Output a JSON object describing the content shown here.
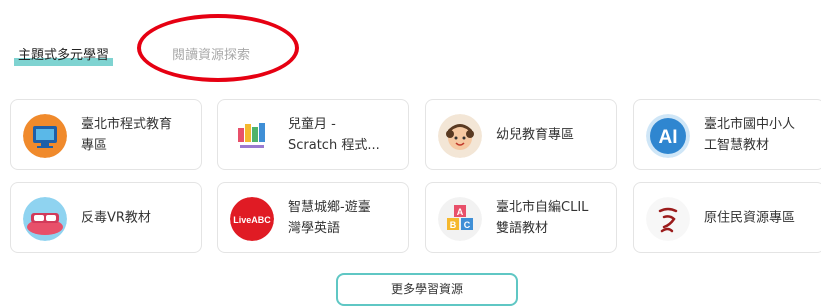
{
  "tabs": [
    {
      "label": "主題式多元學習",
      "active": true
    },
    {
      "label": "閱讀資源探索",
      "active": false
    }
  ],
  "cards": [
    {
      "line1": "臺北市程式教育",
      "line2": "專區",
      "icon": "monitor-icon"
    },
    {
      "line1": "兒童月 -",
      "line2": "Scratch 程式...",
      "icon": "childrens-month-icon"
    },
    {
      "line1": "幼兒教育專區",
      "line2": "",
      "icon": "child-face-icon"
    },
    {
      "line1": "臺北市國中小人",
      "line2": "工智慧教材",
      "icon": "ai-icon"
    },
    {
      "line1": "反毒VR教材",
      "line2": "",
      "icon": "anti-drug-vr-icon"
    },
    {
      "line1": "智慧城鄉-遊臺",
      "line2": "灣學英語",
      "icon": "liveabc-icon"
    },
    {
      "line1": "臺北市自編CLIL",
      "line2": "雙語教材",
      "icon": "abc-blocks-icon"
    },
    {
      "line1": "原住民資源專區",
      "line2": "",
      "icon": "indigenous-logo-icon"
    }
  ],
  "icon_text": {
    "ai": "AI",
    "liveabc": "LiveABC",
    "blocks": [
      "A",
      "B",
      "C"
    ]
  },
  "more_button": "更多學習資源",
  "colors": {
    "accent": "#7fd3d1",
    "button_border": "#5fc7c4",
    "annotation_circle": "#e60012"
  }
}
